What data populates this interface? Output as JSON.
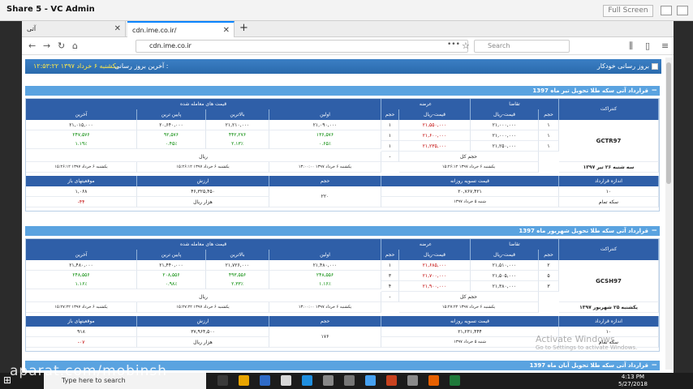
{
  "share_bar": {
    "title": "Share 5 - VC Admin",
    "fullscreen_label": "Full Screen"
  },
  "browser": {
    "tabs": [
      {
        "label": "آتی"
      },
      {
        "label": "cdn.ime.co.ir/"
      }
    ],
    "url": "cdn.ime.co.ir",
    "search_placeholder": "Search"
  },
  "toolbar": {
    "auto_refresh_label": "بروز رسانی خودکار",
    "last_update_label": "آخرین بروز رسانی :",
    "last_update_value": "یکشنبه ۶ خرداد ۱۳۹۷ ۱۲:۵۳:۲۲"
  },
  "contracts": [
    {
      "title": "قرارداد آتی سکه طلا تحویل تیر ماه 1397",
      "code": "GCTR97",
      "expiry": "سه شنبه ۲۶ تیر ۱۳۹۷",
      "headers": {
        "contract": "کنتراکت",
        "demand": "تقاضا",
        "supply": "عرضه",
        "traded": "قیمت های معامله شده",
        "volume": "حجم",
        "price_rial": "قیمت-ریال",
        "first": "اولین",
        "high": "بالاترین",
        "low": "پایین ترین",
        "last": "آخرین",
        "total_volume": "حجم کل",
        "rial": "ریال"
      },
      "demand_rows": [
        [
          "۱",
          "۲۱,۰۰۰,۰۰۰"
        ],
        [
          "۱",
          "۲۱,۰۰۰,۰۰۰"
        ],
        [
          "۱",
          "۲۱,۲۵۰,۰۰۰"
        ]
      ],
      "supply_rows": [
        [
          "۲۱,۵۵۰,۰۰۰",
          "۱"
        ],
        [
          "۲۱,۶۰۰,۰۰۰",
          "۱"
        ],
        [
          "۲۱,۲۳۵,۰۰۰",
          "۱"
        ]
      ],
      "first": [
        "۲۱,۰۹۰,۰۰۰",
        "۱۳۶,۵۷۶",
        "۰.۶۵٪"
      ],
      "high": [
        "۲۱,۲۱۰,۰۰۰",
        "۴۴۲,۲۷۶",
        "۲.۱۳٪"
      ],
      "low": [
        "۲۰,۶۴۰,۰۰۰",
        "۹۲,۵۷۶",
        "۰.۴۵٪"
      ],
      "last": [
        "۲۱,۰۱۵,۰۰۰",
        "۲۴۷,۵۷۶",
        "۱.۱۹٪"
      ],
      "total_volume": "-",
      "timestamps": [
        "یکشنبه ۶ خرداد ۱۳۹۷ ۱۵:۲۶:۱۲",
        "یکشنبه ۶ خرداد ۱۳۹۷ ۱۳:۰۰:۰۰",
        "یکشنبه ۶ خرداد ۱۳۹۷ ۱۵:۲۶:۱۲",
        "یکشنبه ۶ خرداد ۱۳۹۷ ۱۵:۲۶:۱۲"
      ],
      "footer": {
        "size_label": "اندازه قرارداد",
        "settle_label": "قیمت تسویه روزانه",
        "vol_label": "حجم",
        "value_label": "ارزش",
        "open_label": "موقعیتهای باز",
        "size_value": "۱۰",
        "size_unit": "سکه تمام",
        "settle_value": "۲۰,۷۶۷,۴۲۱",
        "settle_date": "شنبه ۵ خرداد ۱۳۹۷",
        "vol_value": "۲۲۰",
        "value_value": "۴۶,۳۲۵,۴۵۰",
        "value_unit": "هزار ریال",
        "open_value": "۱,۰۶۸",
        "open_change": "-۴۴"
      }
    },
    {
      "title": "قرارداد آتی سکه طلا تحویل شهریور ماه 1397",
      "code": "GCSH97",
      "expiry": "یکشنبه ۲۵ شهریور ۱۳۹۷",
      "headers": {
        "contract": "کنتراکت",
        "demand": "تقاضا",
        "supply": "عرضه",
        "traded": "قیمت های معامله شده",
        "volume": "حجم",
        "price_rial": "قیمت-ریال",
        "first": "اولین",
        "high": "بالاترین",
        "low": "پایین ترین",
        "last": "آخرین",
        "total_volume": "حجم کل",
        "rial": "ریال"
      },
      "demand_rows": [
        [
          "۲",
          "۲۱,۵۱۰,۰۰۰"
        ],
        [
          "۵",
          "۲۱,۵۰۵,۰۰۰"
        ],
        [
          "۳",
          "۲۱,۳۸۰,۰۰۰"
        ]
      ],
      "supply_rows": [
        [
          "۲۱,۶۸۵,۰۰۰",
          "۱"
        ],
        [
          "۲۱,۷۰۰,۰۰۰",
          "۳"
        ],
        [
          "۲۱,۹۰۰,۰۰۰",
          "۴"
        ]
      ],
      "first": [
        "۲۱,۴۸۰,۰۰۰",
        "۲۴۸,۵۵۶",
        "۱.۱۶٪"
      ],
      "high": [
        "۲۱,۷۲۶,۰۰۰",
        "۴۹۳,۵۵۶",
        "۲.۳۳٪"
      ],
      "low": [
        "۲۱,۴۴۰,۰۰۰",
        "۲۰۸,۵۵۶",
        "۰.۹۸٪"
      ],
      "last": [
        "۲۱,۴۸۰,۰۰۰",
        "۲۴۸,۵۵۶",
        "۱.۱۶٪"
      ],
      "total_volume": "-",
      "timestamps": [
        "یکشنبه ۶ خرداد ۱۳۹۷ ۱۵:۲۷:۲۲",
        "یکشنبه ۶ خرداد ۱۳۹۷ ۱۳:۰۰:۰۰",
        "یکشنبه ۶ خرداد ۱۳۹۷ ۱۵:۲۷:۲۲",
        "یکشنبه ۶ خرداد ۱۳۹۷ ۱۵:۲۷:۲۲"
      ],
      "footer": {
        "size_label": "اندازه قرارداد",
        "settle_label": "قیمت تسویه روزانه",
        "vol_label": "حجم",
        "value_label": "ارزش",
        "open_label": "موقعیتهای باز",
        "size_value": "۱۰",
        "size_unit": "سکه تمام",
        "settle_value": "۲۱,۲۳۱,۴۴۴",
        "settle_date": "شنبه ۵ خرداد ۱۳۹۷",
        "vol_value": "۱۷۶",
        "value_value": "۳۷,۹۶۴,۵۰۰",
        "value_unit": "هزار ریال",
        "open_value": "۹۱۸",
        "open_change": "-۰۷"
      }
    }
  ],
  "third_title": "قرارداد آتی سکه طلا تحویل آبان ماه 1397",
  "taskbar": {
    "search_placeholder": "Type here to search",
    "time": "4:13 PM",
    "date": "5/27/2018"
  },
  "overlays": {
    "watermark": "aparat.com/mobinsh",
    "activate_title": "Activate Windows",
    "activate_sub": "Go to Settings to activate Windows."
  }
}
